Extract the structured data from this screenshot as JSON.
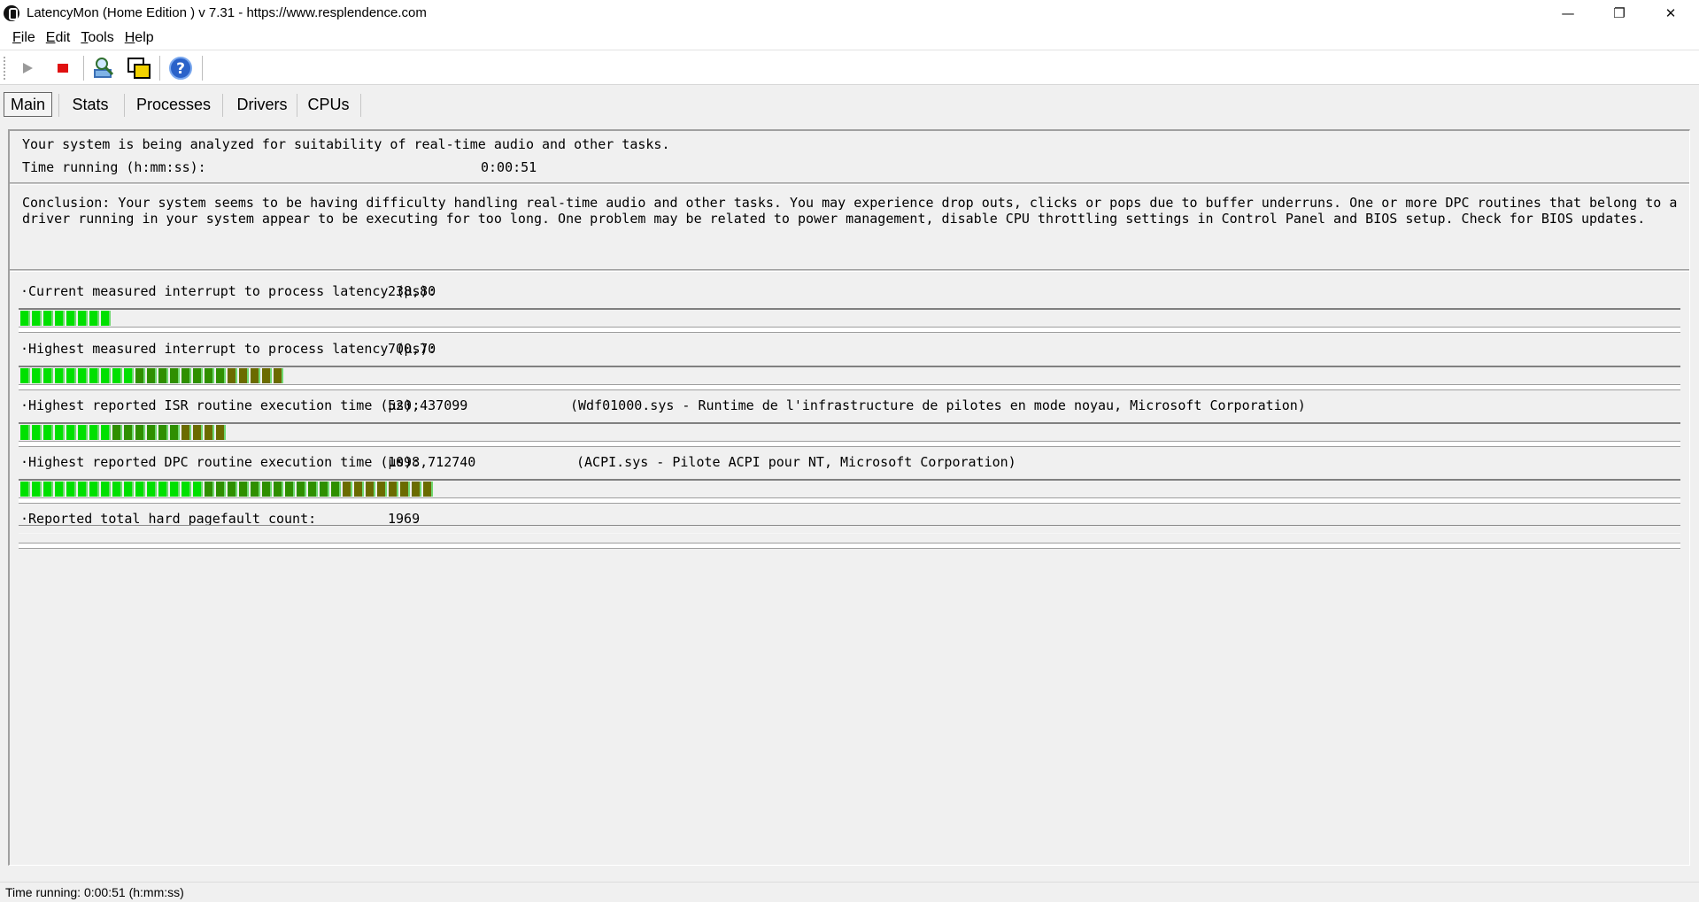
{
  "window": {
    "title": "LatencyMon  (Home Edition )  v 7.31 - https://www.resplendence.com",
    "minimize_glyph": "—",
    "maximize_glyph": "❐",
    "close_glyph": "✕"
  },
  "menu": {
    "items": [
      "File",
      "Edit",
      "Tools",
      "Help"
    ]
  },
  "toolbar": {
    "icons": [
      "play-icon",
      "stop-icon",
      "search-driver-icon",
      "copy-windows-icon",
      "help-icon"
    ],
    "colors": {
      "play": "#9a9a9a",
      "stop": "#e01010",
      "help": "#2a62c9"
    }
  },
  "tabs": {
    "items": [
      "Main",
      "Stats",
      "Processes",
      "Drivers",
      "CPUs"
    ],
    "active": "Main"
  },
  "main": {
    "analysis_text": "Your system is being analyzed for suitability of real-time audio and other tasks.",
    "time_running_label": "Time running (h:mm:ss):",
    "time_running_value": "0:00:51",
    "conclusion": "Conclusion: Your system seems to be having difficulty handling real-time audio and other tasks. You may experience drop outs, clicks or pops due to buffer underruns. One or more DPC routines that belong to a driver running in your system appear to be executing for too long. One problem may be related to power management, disable CPU throttling settings in Control Panel and BIOS setup. Check for BIOS updates.",
    "metrics": [
      {
        "label": "·Current measured interrupt to process latency (µs):",
        "value": "238,80",
        "extra": "",
        "level_fraction": 0.07,
        "segments": 8,
        "has_bar": true
      },
      {
        "label": "·Highest measured interrupt to process latency (µs):",
        "value": "700,70",
        "extra": "",
        "level_fraction": 0.2,
        "segments": 23,
        "has_bar": true
      },
      {
        "label": "·Highest reported ISR routine execution time (µs):",
        "value": "520,437099",
        "extra": "(Wdf01000.sys - Runtime de l'infrastructure de pilotes en mode noyau, Microsoft Corporation)",
        "level_fraction": 0.15,
        "segments": 18,
        "has_bar": true
      },
      {
        "label": "·Highest reported DPC routine execution time (µs):",
        "value": "1098,712740",
        "extra": "(ACPI.sys - Pilote ACPI pour NT, Microsoft Corporation)",
        "level_fraction": 0.31,
        "segments": 36,
        "has_bar": true
      },
      {
        "label": "·Reported total hard pagefault count:",
        "value": "1969",
        "extra": "",
        "level_fraction": 0,
        "segments": 0,
        "has_bar": true
      }
    ],
    "bar_colors": {
      "green": "#00e000",
      "dark_green": "#2f8f00",
      "olive": "#6b6b00"
    }
  },
  "status": {
    "text": "Time running: 0:00:51  (h:mm:ss)"
  }
}
